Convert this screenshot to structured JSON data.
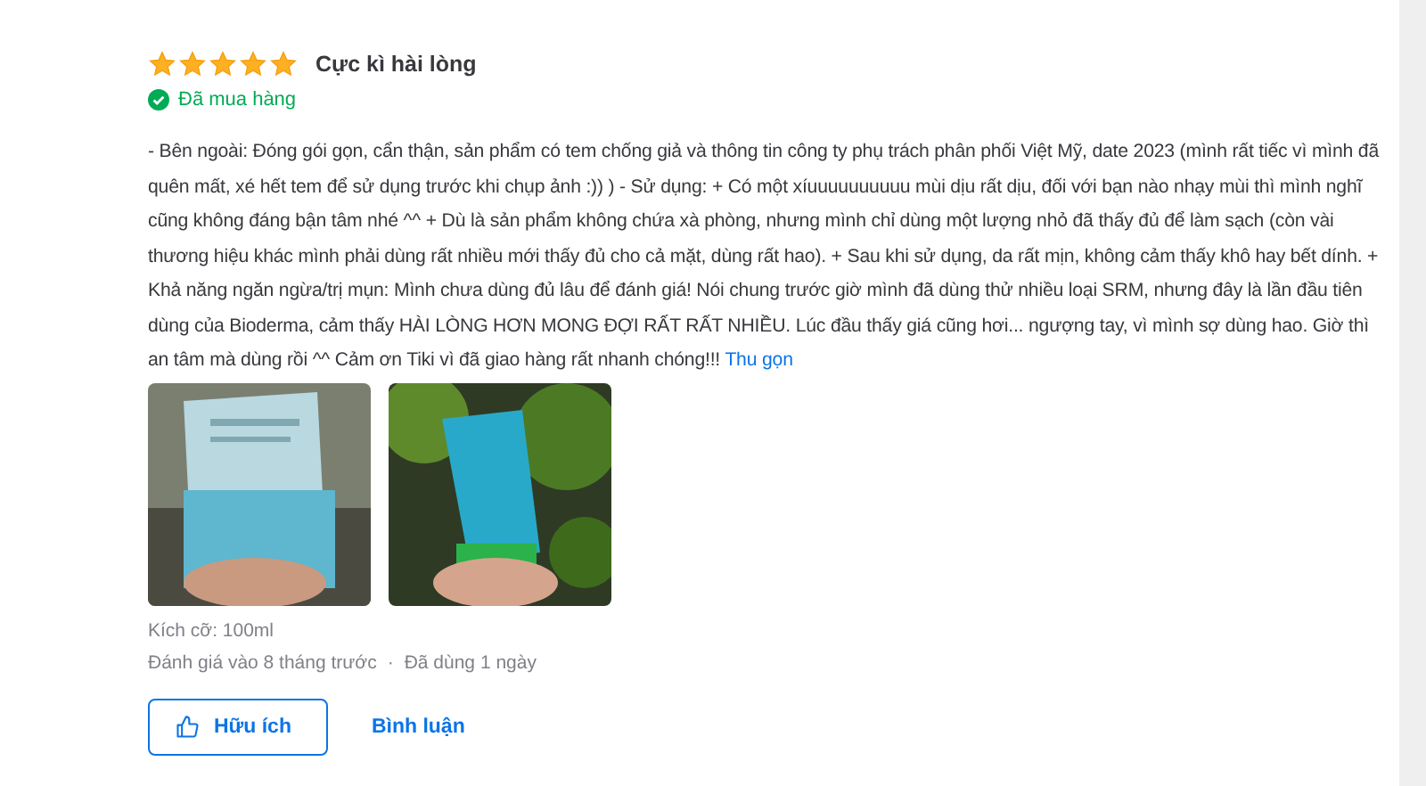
{
  "review": {
    "stars": 5,
    "title": "Cực kì hài lòng",
    "verified": "Đã mua hàng",
    "body": "- Bên ngoài: Đóng gói gọn, cẩn thận, sản phẩm có tem chống giả và thông tin công ty phụ trách phân phối Việt Mỹ, date 2023 (mình rất tiếc vì mình đã quên mất, xé hết tem để sử dụng trước khi chụp ảnh :)) ) - Sử dụng: + Có một xíuuuuuuuuuu mùi dịu rất dịu, đối với bạn nào nhạy mùi thì mình nghĩ cũng không đáng bận tâm nhé ^^ + Dù là sản phẩm không chứa xà phòng, nhưng mình chỉ dùng một lượng nhỏ đã thấy đủ để làm sạch (còn vài thương hiệu khác mình phải dùng rất nhiều mới thấy đủ cho cả mặt, dùng rất hao). + Sau khi sử dụng, da rất mịn, không cảm thấy khô hay bết dính. + Khả năng ngăn ngừa/trị mụn: Mình chưa dùng đủ lâu để đánh giá! Nói chung trước giờ mình đã dùng thử nhiều loại SRM, nhưng đây là lần đầu tiên dùng của Bioderma, cảm thấy HÀI LÒNG HƠN MONG ĐỢI RẤT RẤT NHIỀU. Lúc đầu thấy giá cũng hơi... ngượng tay, vì mình sợ dùng hao. Giờ thì an tâm mà dùng rồi ^^ Cảm ơn Tiki vì đã giao hàng rất nhanh chóng!!!",
    "collapse_link": "Thu gọn",
    "photos": [
      {
        "kind": "picture"
      },
      {
        "kind": "picture"
      }
    ],
    "size": "Kích cỡ: 100ml",
    "meta": [
      "Đánh giá vào 8 tháng trước",
      "Đã dùng 1 ngày"
    ],
    "separator": "·",
    "buttons": [
      {
        "label": "Hữu ích",
        "kind": "outlined"
      },
      {
        "label": "Bình luận",
        "kind": "text"
      }
    ]
  }
}
